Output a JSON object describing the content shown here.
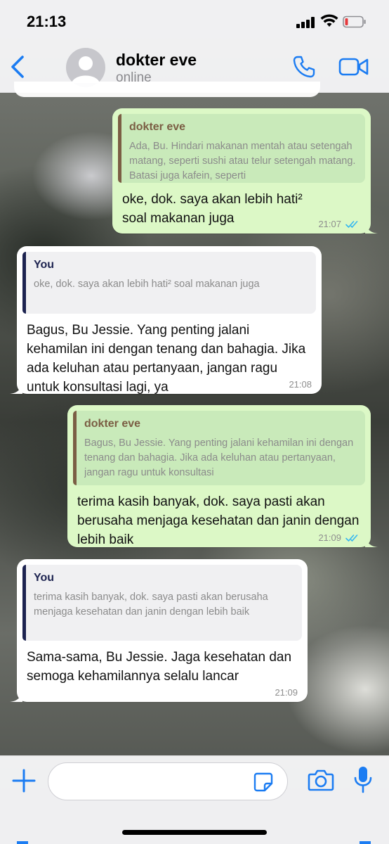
{
  "status_bar": {
    "time": "21:13"
  },
  "header": {
    "contact_name": "dokter eve",
    "contact_status": "online"
  },
  "colors": {
    "accent": "#1b7cf2",
    "outgoing_bubble": "#dcf8c6",
    "incoming_bubble": "#ffffff",
    "read_ticks": "#34b7f1"
  },
  "messages": [
    {
      "direction": "outgoing",
      "quote_author": "dokter eve",
      "quote_text": "Ada, Bu. Hindari makanan mentah atau setengah matang, seperti sushi atau telur setengah matang. Batasi juga kafein, seperti",
      "text": "oke, dok. saya akan lebih hati² soal makanan juga",
      "time": "21:07",
      "read": true
    },
    {
      "direction": "incoming",
      "quote_author": "You",
      "quote_text": "oke, dok. saya akan lebih hati² soal makanan juga",
      "text": "Bagus, Bu Jessie. Yang penting jalani kehamilan ini dengan tenang dan bahagia. Jika ada keluhan atau pertanyaan, jangan ragu untuk konsultasi lagi, ya",
      "time": "21:08"
    },
    {
      "direction": "outgoing",
      "quote_author": "dokter eve",
      "quote_text": "Bagus, Bu Jessie. Yang penting jalani kehamilan ini dengan tenang dan bahagia. Jika ada keluhan atau pertanyaan, jangan ragu untuk konsultasi",
      "text": "terima kasih banyak, dok. saya pasti akan berusaha menjaga kesehatan dan janin dengan lebih baik",
      "time": "21:09",
      "read": true
    },
    {
      "direction": "incoming",
      "quote_author": "You",
      "quote_text": "terima kasih banyak, dok. saya pasti akan berusaha menjaga kesehatan dan janin dengan lebih baik",
      "text": "Sama-sama, Bu Jessie. Jaga kesehatan dan semoga kehamilannya selalu lancar",
      "time": "21:09"
    }
  ],
  "composer": {
    "value": "",
    "placeholder": ""
  }
}
